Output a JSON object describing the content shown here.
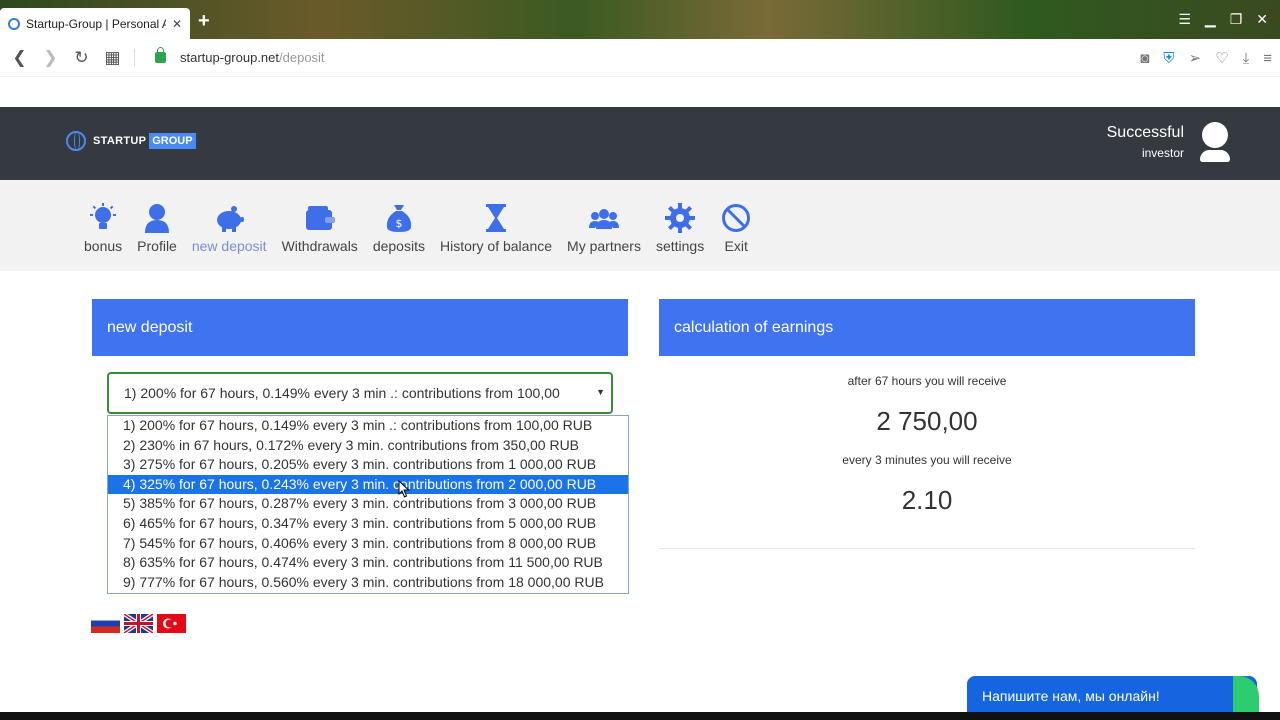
{
  "browser": {
    "tab_title": "Startup-Group | Personal A",
    "tab_close": "✕",
    "new_tab": "+",
    "url_host": "startup-group.net",
    "url_path": "/deposit"
  },
  "header": {
    "logo_part1": "STARTUP",
    "logo_part2": "GROUP",
    "status_title": "Successful",
    "status_sub": "investor"
  },
  "menu": {
    "items": [
      {
        "label": "bonus",
        "icon": "lightbulb-icon"
      },
      {
        "label": "Profile",
        "icon": "user-icon"
      },
      {
        "label": "new deposit",
        "icon": "piggy-bank-icon",
        "active": true
      },
      {
        "label": "Withdrawals",
        "icon": "wallet-icon"
      },
      {
        "label": "deposits",
        "icon": "money-bag-icon"
      },
      {
        "label": "History of balance",
        "icon": "hourglass-icon"
      },
      {
        "label": "My partners",
        "icon": "users-icon"
      },
      {
        "label": "settings",
        "icon": "gear-icon"
      },
      {
        "label": "Exit",
        "icon": "ban-icon"
      }
    ]
  },
  "deposit": {
    "title": "new deposit",
    "selected": "1) 200% for 67 hours, 0.149% every 3 min .: contributions from 100,00",
    "options": [
      "1) 200% for 67 hours, 0.149% every 3 min .: contributions from 100,00 RUB",
      "2) 230% in 67 hours, 0.172% every 3 min. contributions from 350,00 RUB",
      "3) 275% for 67 hours, 0.205% every 3 min. contributions from 1 000,00 RUB",
      "4) 325% for 67 hours, 0.243% every 3 min. contributions from 2 000,00 RUB",
      "5) 385% for 67 hours, 0.287% every 3 min. contributions from 3 000,00 RUB",
      "6) 465% for 67 hours, 0.347% every 3 min. contributions from 5 000,00 RUB",
      "7) 545% for 67 hours, 0.406% every 3 min. contributions from 8 000,00 RUB",
      "8) 635% for 67 hours, 0.474% every 3 min. contributions from 11 500,00 RUB",
      "9) 777% for 67 hours, 0.560% every 3 min. contributions from 18 000,00 RUB"
    ],
    "highlighted_index": 3
  },
  "calculation": {
    "title": "calculation of earnings",
    "label_total": "after 67 hours you will receive",
    "total": "2 750,00",
    "label_step": "every 3 minutes you will receive",
    "step": "2.10"
  },
  "chat": {
    "label": "Напишите нам, мы онлайн!"
  },
  "colors": {
    "accent": "#4073f0",
    "header_bg": "#343a40",
    "selected_option": "#1a73e8"
  }
}
